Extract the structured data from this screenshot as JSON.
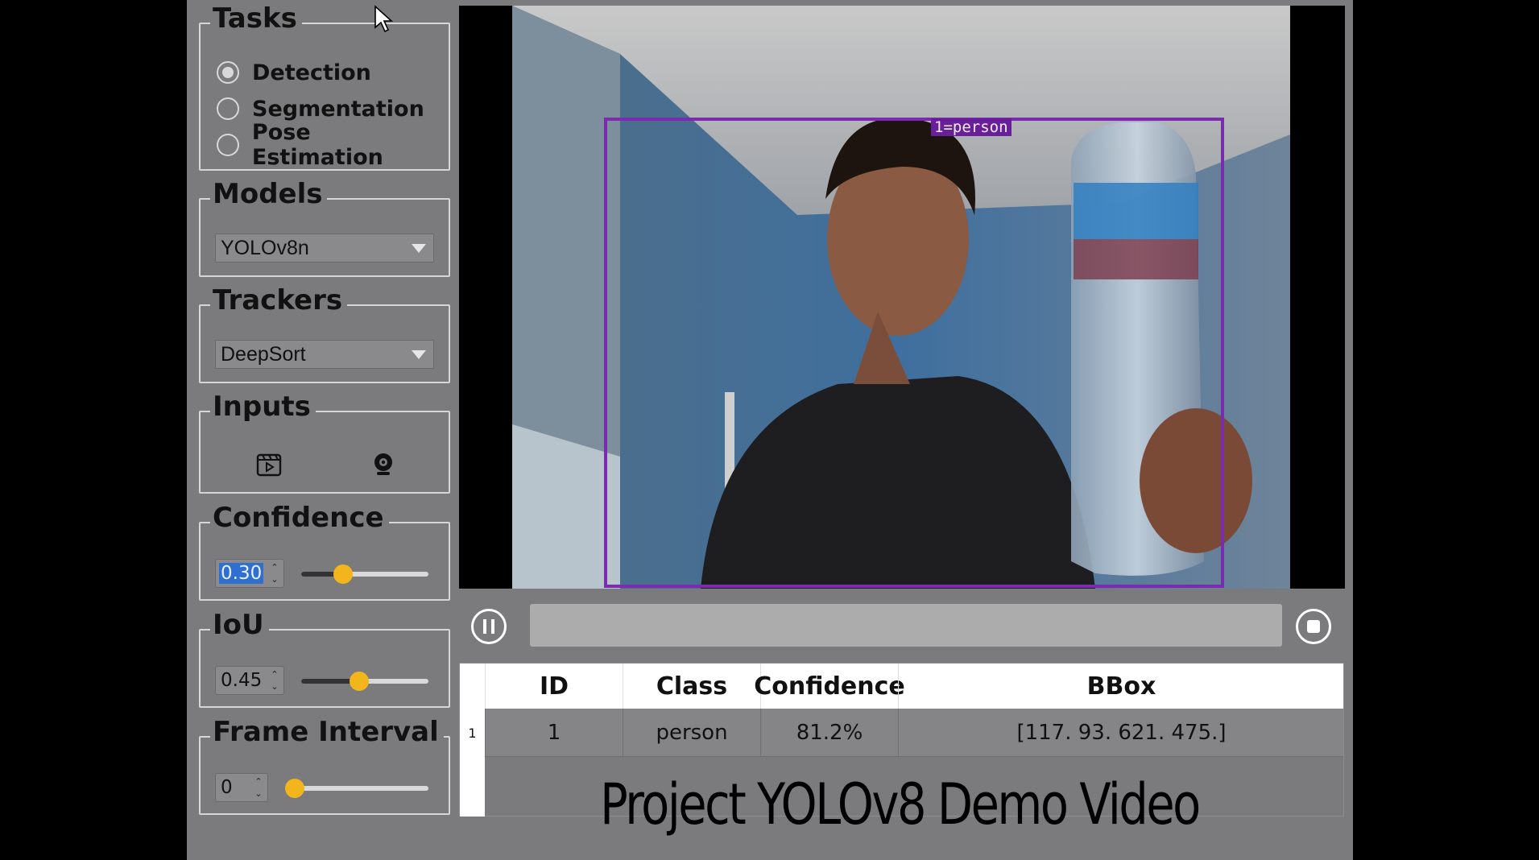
{
  "tasks": {
    "title": "Tasks",
    "options": [
      {
        "label": "Detection",
        "selected": true
      },
      {
        "label": "Segmentation",
        "selected": false
      },
      {
        "label": "Pose Estimation",
        "selected": false
      }
    ]
  },
  "models": {
    "title": "Models",
    "selected": "YOLOv8n"
  },
  "trackers": {
    "title": "Trackers",
    "selected": "DeepSort"
  },
  "inputs": {
    "title": "Inputs",
    "video_icon": "video-file-icon",
    "webcam_icon": "webcam-icon"
  },
  "confidence": {
    "title": "Confidence",
    "value": "0.30",
    "fraction": 0.3
  },
  "iou": {
    "title": "IoU",
    "value": "0.45",
    "fraction": 0.45
  },
  "frame_interval": {
    "title": "Frame Interval",
    "value": "0",
    "fraction": 0.0
  },
  "video": {
    "detection_label": "1=person",
    "box_color": "#7a2bb0"
  },
  "controls": {
    "pause_icon": "pause-icon",
    "stop_icon": "stop-icon"
  },
  "table": {
    "headers": [
      "ID",
      "Class",
      "Confidence",
      "BBox"
    ],
    "rows": [
      {
        "row_number": "1",
        "id": "1",
        "class": "person",
        "confidence": "81.2%",
        "bbox": "[117.  93. 621. 475.]"
      }
    ]
  },
  "caption": "Project  YOLOv8 Demo Video",
  "colors": {
    "panel_bg": "#7b7b7d",
    "accent_handle": "#f2b51b"
  }
}
